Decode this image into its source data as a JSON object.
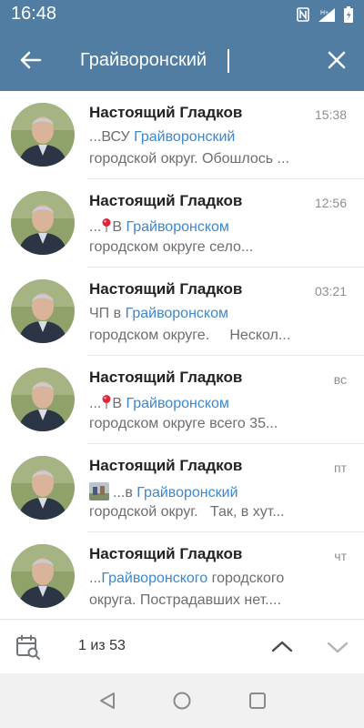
{
  "status_bar": {
    "time": "16:48",
    "icons": [
      "nfc-icon",
      "signal-icon",
      "battery-icon"
    ],
    "network_label": "H+"
  },
  "toolbar": {
    "search_value": "Грайворонский",
    "icons": [
      "back-arrow-icon",
      "close-icon"
    ]
  },
  "results": [
    {
      "name": "Настоящий Гладков",
      "time": "15:38",
      "line1_prefix": "...ВСУ ",
      "line1_highlight": "Грайворонский",
      "line1_suffix": "",
      "line2": "городской округ. Обошлось ..."
    },
    {
      "name": "Настоящий Гладков",
      "time": "12:56",
      "line1_prefix": "...",
      "line1_emoji": "round-pushpin-icon",
      "line1_mid": "В ",
      "line1_highlight": "Грайворонском",
      "line2": "городском округе село..."
    },
    {
      "name": "Настоящий Гладков",
      "time": "03:21",
      "line1_prefix": "ЧП в ",
      "line1_highlight": "Грайворонском",
      "line2": "городском округе.     Нескол..."
    },
    {
      "name": "Настоящий Гладков",
      "time": "вс",
      "line1_prefix": "...",
      "line1_emoji": "round-pushpin-icon",
      "line1_mid": "В ",
      "line1_highlight": "Грайворонском",
      "line2": "городском округе всего 35..."
    },
    {
      "name": "Настоящий Гладков",
      "time": "пт",
      "line1_prefix": "...в ",
      "line1_highlight": "Грайворонский",
      "line1_thumb": "photo-thumbnail",
      "line2": "городской округ.   Так, в хут..."
    },
    {
      "name": "Настоящий Гладков",
      "time": "чт",
      "line1_prefix": "...",
      "line1_highlight": "Грайворонского",
      "line1_suffix": " городского",
      "line2": "округа. Пострадавших нет...."
    }
  ],
  "search_bar": {
    "counter": "1 из 53",
    "icons": [
      "calendar-search-icon",
      "chevron-up-icon",
      "chevron-down-icon"
    ]
  },
  "nav_bar": {
    "icons": [
      "nav-back-icon",
      "nav-home-icon",
      "nav-recents-icon"
    ]
  },
  "colors": {
    "header": "#517da2",
    "highlight": "#3d87cc",
    "snippet_text": "#6d6d72",
    "time_text": "#8e8e93"
  }
}
